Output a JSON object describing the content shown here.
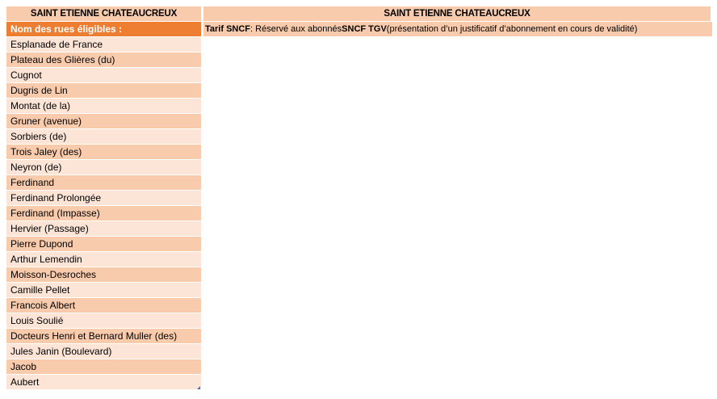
{
  "left": {
    "title": "SAINT ETIENNE CHATEAUCREUX",
    "header": "Nom des rues éligibles :",
    "streets": [
      "Esplanade de France",
      "Plateau des Glières (du)",
      "Cugnot",
      "Dugris de Lin",
      "Montat (de la)",
      "Gruner (avenue)",
      "Sorbiers (de)",
      "Trois Jaley (des)",
      "Neyron (de)",
      "Ferdinand",
      "Ferdinand Prolongée",
      "Ferdinand (Impasse)",
      "Hervier (Passage)",
      "Pierre Dupond",
      "Arthur Lemendin",
      "Moisson-Desroches",
      "Camille Pellet",
      "Francois Albert",
      "Louis Soulié",
      "Docteurs Henri et Bernard Muller (des)",
      "Jules Janin (Boulevard)",
      "Jacob",
      "Aubert"
    ]
  },
  "right": {
    "title": "SAINT ETIENNE CHATEAUCREUX",
    "tarif_label": "Tarif SNCF",
    "tarif_sep": " : Réservé aux abonnés ",
    "tarif_bold": "SNCF TGV",
    "tarif_rest": " (présentation d’un justificatif d’abonnement en cours de validité)"
  },
  "colors": {
    "header_orange": "#ed7d31",
    "row_light": "#fce4d6",
    "row_dark": "#f8cbad"
  }
}
